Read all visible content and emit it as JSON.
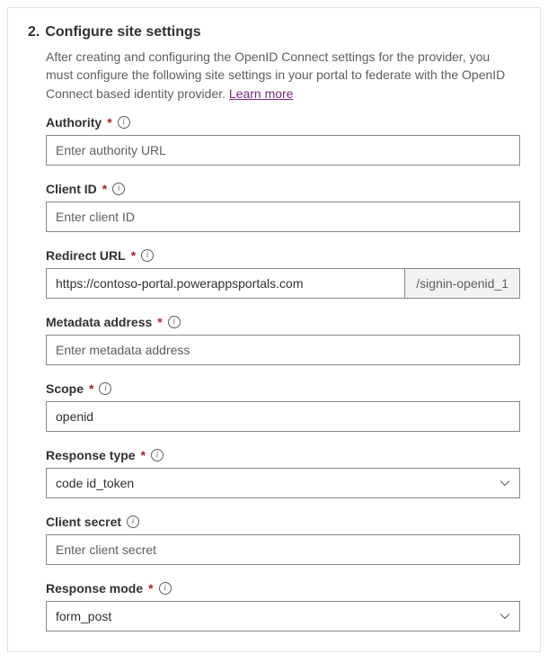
{
  "step": {
    "number": "2.",
    "title": "Configure site settings",
    "description": "After creating and configuring the OpenID Connect settings for the provider, you must configure the following site settings in your portal to federate with the OpenID Connect based identity provider. ",
    "learn_more": "Learn more"
  },
  "fields": {
    "authority": {
      "label": "Authority",
      "required": "*",
      "placeholder": "Enter authority URL",
      "value": ""
    },
    "client_id": {
      "label": "Client ID",
      "required": "*",
      "placeholder": "Enter client ID",
      "value": ""
    },
    "redirect_url": {
      "label": "Redirect URL",
      "required": "*",
      "value": "https://contoso-portal.powerappsportals.com",
      "suffix": "/signin-openid_1"
    },
    "metadata": {
      "label": "Metadata address",
      "required": "*",
      "placeholder": "Enter metadata address",
      "value": ""
    },
    "scope": {
      "label": "Scope",
      "required": "*",
      "value": "openid"
    },
    "response_type": {
      "label": "Response type",
      "required": "*",
      "value": "code id_token"
    },
    "client_secret": {
      "label": "Client secret",
      "placeholder": "Enter client secret",
      "value": ""
    },
    "response_mode": {
      "label": "Response mode",
      "required": "*",
      "value": "form_post"
    }
  }
}
